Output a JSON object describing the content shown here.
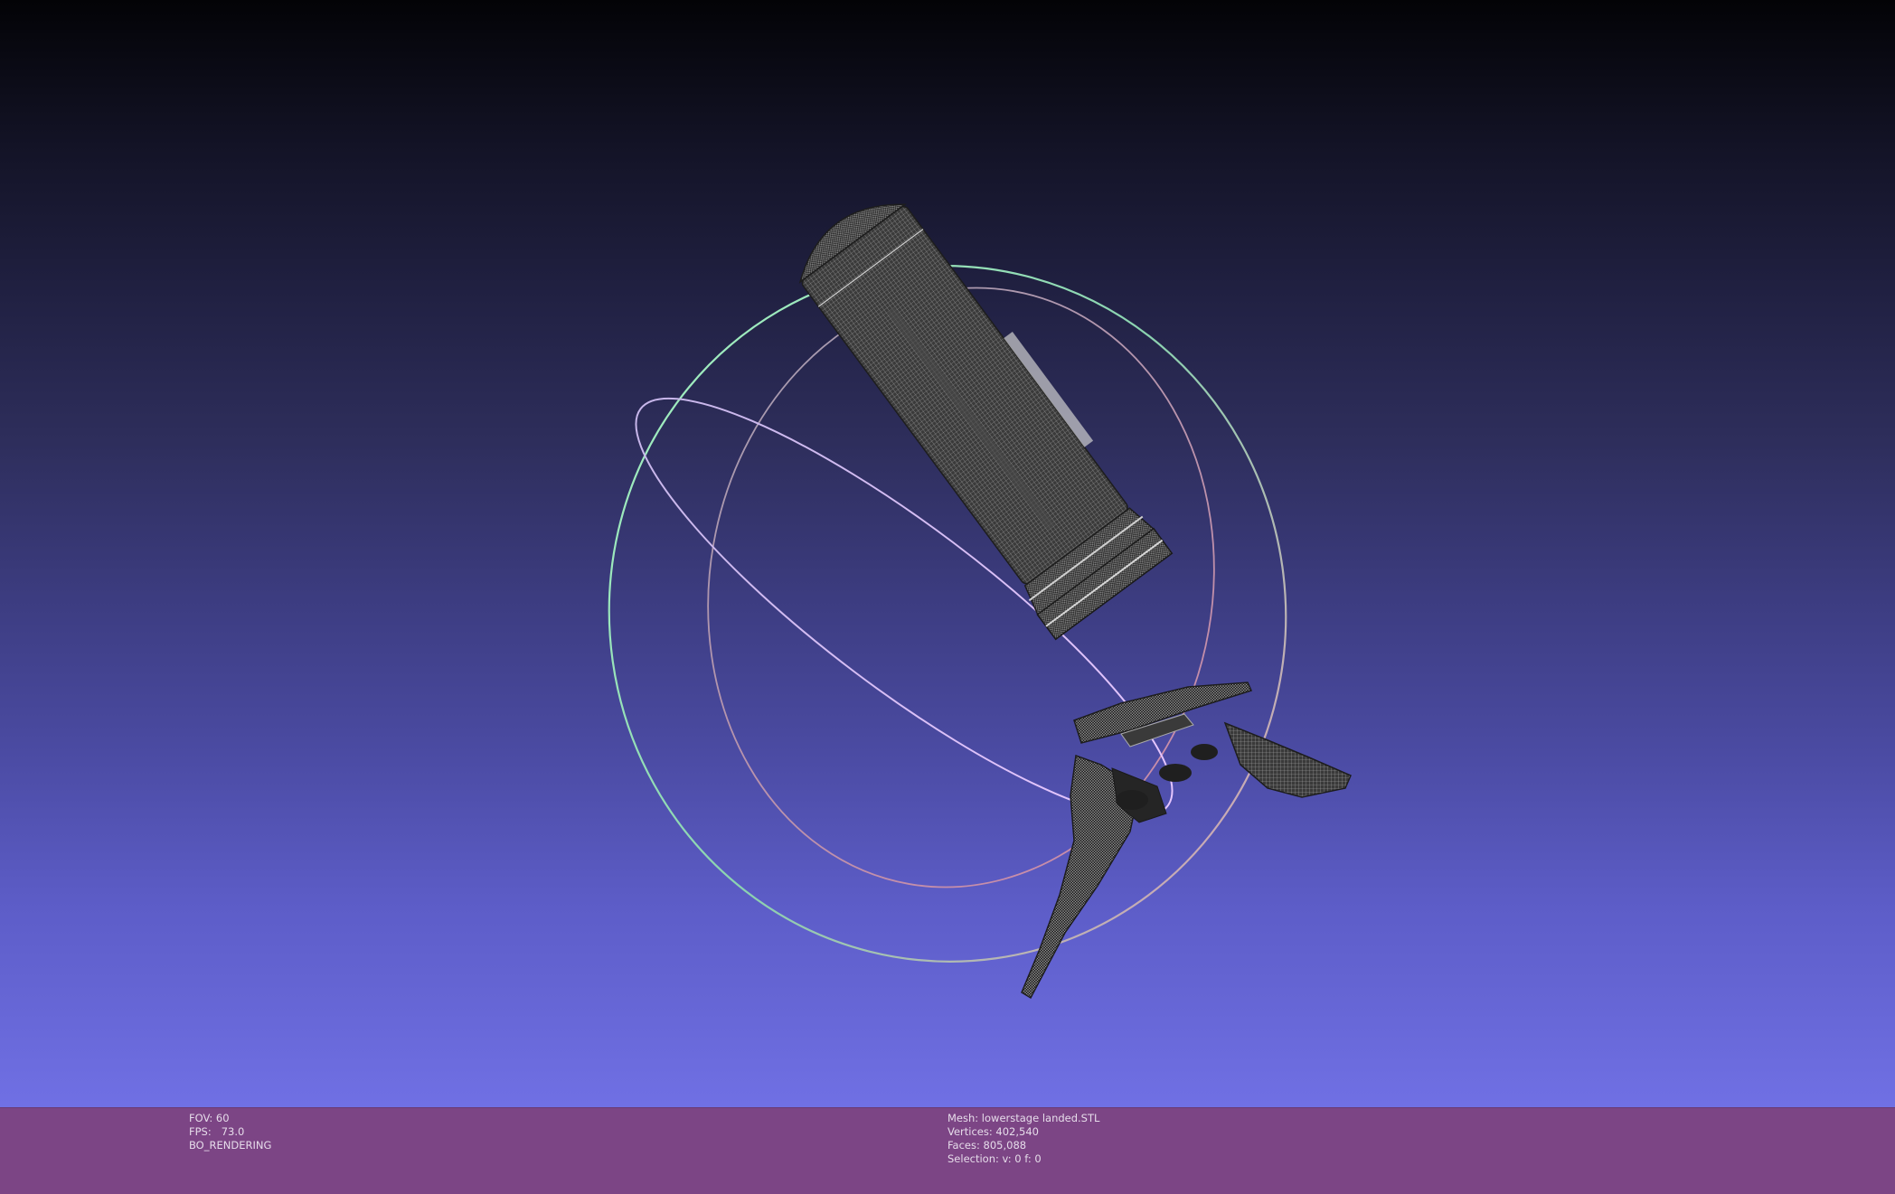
{
  "render_info": {
    "fov": "FOV: 60",
    "fps": "FPS:   73.0",
    "mode": "BO_RENDERING"
  },
  "mesh_info": {
    "mesh": "Mesh: lowerstage landed.STL",
    "vertices": "Vertices: 402,540",
    "faces": "Faces: 805,088",
    "selection": "Selection: v: 0 f: 0"
  },
  "colors": {
    "background_top": "#030306",
    "background_bottom": "#7070e4",
    "info_bar": "#7c4585",
    "trackball_ring_x": "#e3a1b8",
    "trackball_ring_y": "#9ff0c0",
    "trackball_ring_z": "#d9b8ff",
    "mesh_wire": "#9a9a9a"
  }
}
